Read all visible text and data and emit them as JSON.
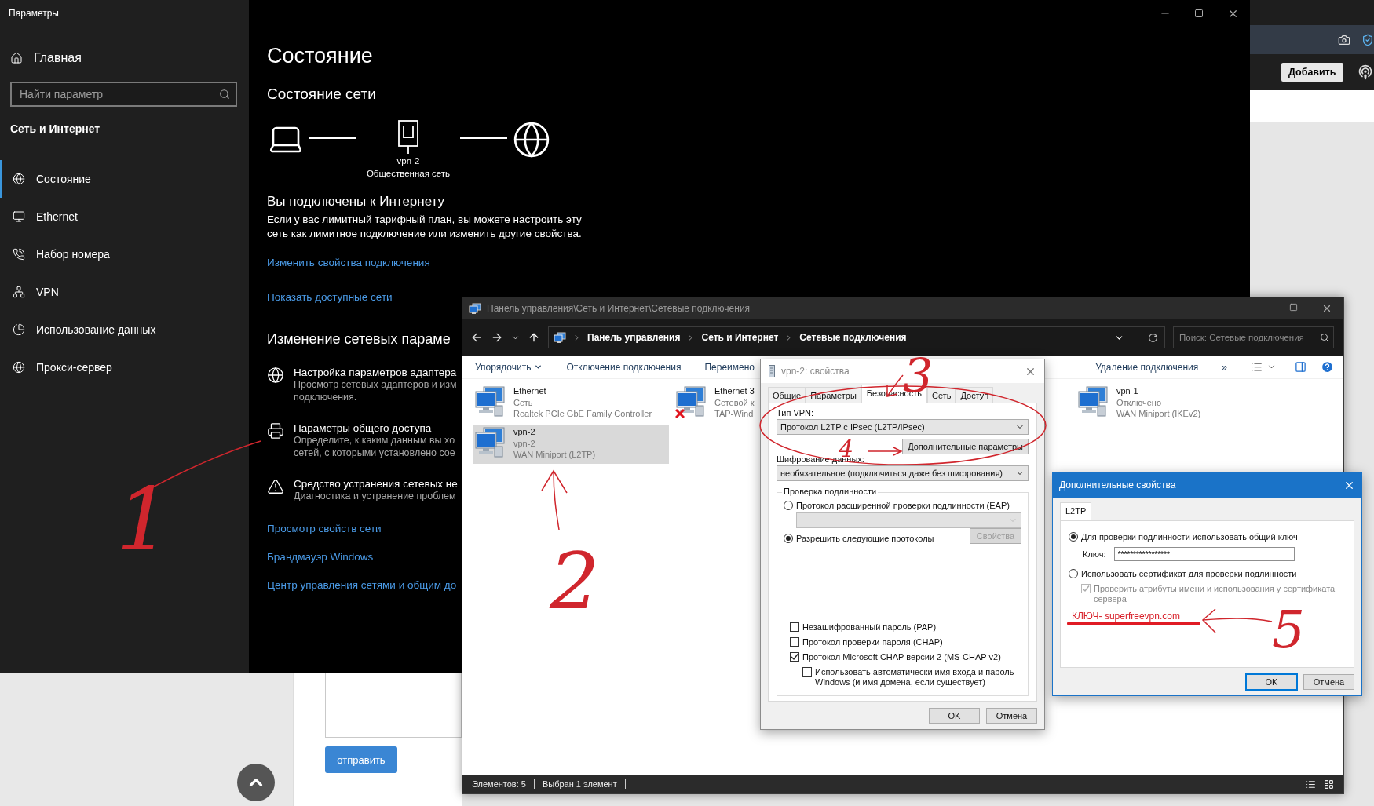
{
  "settings": {
    "title": "Параметры",
    "home": "Главная",
    "search_placeholder": "Найти параметр",
    "section": "Сеть и Интернет",
    "nav": [
      {
        "kind": "status",
        "label": "Состояние",
        "selected": true
      },
      {
        "kind": "ethernet",
        "label": "Ethernet",
        "selected": false
      },
      {
        "kind": "dialup",
        "label": "Набор номера",
        "selected": false
      },
      {
        "kind": "vpn",
        "label": "VPN",
        "selected": false
      },
      {
        "kind": "data",
        "label": "Использование данных",
        "selected": false
      },
      {
        "kind": "proxy",
        "label": "Прокси-сервер",
        "selected": false
      }
    ],
    "heading": "Состояние",
    "subheading": "Состояние сети",
    "network": {
      "name": "vpn-2",
      "type": "Общественная сеть"
    },
    "connected_title": "Вы подключены к Интернету",
    "connected_text": "Если у вас лимитный тарифный план, вы можете настроить эту сеть как лимитное подключение или изменить другие свойства.",
    "links_top": [
      "Изменить свойства подключения",
      "Показать доступные сети"
    ],
    "change_heading": "Изменение сетевых параме",
    "options": [
      {
        "kind": "adapter",
        "title": "Настройка параметров адаптера",
        "description": [
          "Просмотр сетевых адаптеров и изм",
          "подключения."
        ]
      },
      {
        "kind": "sharing",
        "title": "Параметры общего доступа",
        "description": [
          "Определите, к каким данным вы хо",
          "сетей, с которыми установлено сое"
        ]
      },
      {
        "kind": "troubleshoot",
        "title": "Средство устранения сетевых не",
        "description": [
          "Диагностика и устранение проблем"
        ]
      }
    ],
    "links_bottom": [
      "Просмотр свойств сети",
      "Брандмауэр Windows",
      "Центр управления сетями и общим до"
    ]
  },
  "browser": {
    "add_button": "Добавить",
    "send_button": "отправить"
  },
  "explorer": {
    "title": "Панель управления\\Сеть и Интернет\\Сетевые подключения",
    "breadcrumbs": [
      "Панель управления",
      "Сеть и Интернет",
      "Сетевые подключения"
    ],
    "search_placeholder": "Поиск: Сетевые подключения",
    "toolbar": [
      "Упорядочить",
      "Отключение подключения",
      "Переимено"
    ],
    "toolbar_right": [
      "Удаление подключения",
      "»"
    ],
    "items": [
      {
        "name": "Ethernet",
        "status": "Сеть",
        "device": "Realtek PCIe GbE Family Controller",
        "selected": false,
        "unplugged": false
      },
      {
        "name": "Ethernet 3",
        "status": "Сетевой к",
        "device": "TAP-Wind",
        "selected": false,
        "unplugged": true
      },
      {
        "name": "vpn-1",
        "status": "Отключено",
        "device": "WAN Miniport (IKEv2)",
        "selected": false,
        "unplugged": false
      },
      {
        "name": "vpn-2",
        "status": "vpn-2",
        "device": "WAN Miniport (L2TP)",
        "selected": true,
        "unplugged": false
      }
    ],
    "status": [
      "Элементов: 5",
      "Выбран 1 элемент"
    ]
  },
  "vpn_dialog": {
    "title": "vpn-2: свойства",
    "tabs": [
      {
        "label": "Общие",
        "selected": false
      },
      {
        "label": "Параметры",
        "selected": false
      },
      {
        "label": "Безопасность",
        "selected": true
      },
      {
        "label": "Сеть",
        "selected": false
      },
      {
        "label": "Доступ",
        "selected": false
      }
    ],
    "vpn_type_label": "Тип VPN:",
    "vpn_type": "Протокол L2TP с IPsec (L2TP/IPsec)",
    "advanced_button": "Дополнительные параметры",
    "encryption_label": "Шифрование данных:",
    "encryption": "необязательное (подключиться даже без шифрования)",
    "auth_group": "Проверка подлинности",
    "eap_radio": {
      "label": "Протокол расширенной проверки подлинности (EAP)",
      "selected": false
    },
    "eap_select": {
      "disabled": true
    },
    "protocols_radio": {
      "label": "Разрешить следующие протоколы",
      "selected": true
    },
    "properties_button": {
      "label": "Свойства",
      "disabled": true
    },
    "protocols": [
      {
        "label": "Незашифрованный пароль (PAP)",
        "checked": false
      },
      {
        "label": "Протокол проверки пароля (CHAP)",
        "checked": false
      },
      {
        "label": "Протокол Microsoft CHAP версии 2 (MS-CHAP v2)",
        "checked": true,
        "children": [
          {
            "label": "Использовать автоматически имя входа и пароль Windows (и имя домена, если существует)",
            "checked": false
          }
        ]
      }
    ],
    "buttons": [
      "OK",
      "Отмена"
    ]
  },
  "advanced_dialog": {
    "title": "Дополнительные свойства",
    "tab": "L2TP",
    "psk_radio": {
      "label": "Для проверки подлинности использовать общий ключ",
      "selected": true
    },
    "key_label": "Ключ:",
    "key_value": "*****************",
    "cert_radio": {
      "label": "Использовать сертификат для проверки подлинности",
      "selected": false
    },
    "verify_checkbox": {
      "label": "Проверить атрибуты имени и использования у сертификата сервера",
      "checked": true,
      "disabled": true
    },
    "note": "КЛЮЧ- superfreevpn.com",
    "buttons": [
      "OK",
      "Отмена"
    ]
  },
  "annotations": [
    {
      "label": "1"
    },
    {
      "label": "2"
    },
    {
      "label": "3"
    },
    {
      "label": "4"
    },
    {
      "label": "5"
    }
  ]
}
